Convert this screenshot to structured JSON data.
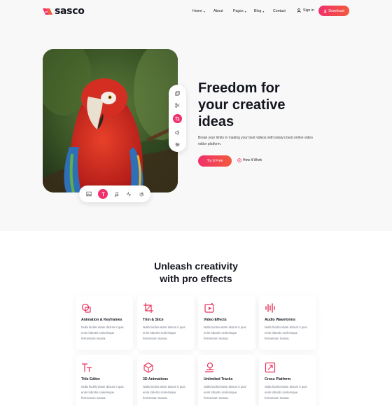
{
  "brand": {
    "name": "sasco",
    "accent": "#f0306a",
    "accent2": "#f25a3e"
  },
  "nav": {
    "items": [
      {
        "label": "Home",
        "has_dropdown": true
      },
      {
        "label": "About",
        "has_dropdown": false
      },
      {
        "label": "Pages",
        "has_dropdown": true
      },
      {
        "label": "Blog",
        "has_dropdown": true
      },
      {
        "label": "Contact",
        "has_dropdown": false
      }
    ],
    "caret": "▾",
    "signin_label": "Sign in",
    "download_label": "Download"
  },
  "hero": {
    "title_lines": [
      "Freedom for",
      "your creative",
      "ideas"
    ],
    "description": "Break your limits in making your best videos with today's best online video editor platform.",
    "primary_cta": "Try It Free",
    "secondary_cta": "How It Work",
    "side_tools": [
      "layers-icon",
      "scissors-icon",
      "crop-icon",
      "volume-icon",
      "sliders-icon"
    ],
    "side_active": "crop-icon",
    "bottom_tools": [
      "image-icon",
      "text-icon",
      "music-icon",
      "waveform-icon",
      "gear-icon"
    ],
    "bottom_active": "text-icon"
  },
  "features": {
    "title_lines": [
      "Unleash creativity",
      "with pro effects"
    ],
    "items": [
      {
        "title": "Animation & Keyframes",
        "desc": "Nulla facilisi etiam dictum it quis enim lobortis scelerisque fermentum massa.",
        "icon": "animation-icon"
      },
      {
        "title": "Trim & Slice",
        "desc": "Nulla facilisi etiam dictum it quis enim lobortis scelerisque fermentum massa.",
        "icon": "crop-icon"
      },
      {
        "title": "Video Effects",
        "desc": "Nulla facilisi etiam dictum it quis enim lobortis scelerisque fermentum massa.",
        "icon": "video-effects-icon"
      },
      {
        "title": "Audio Waveforms",
        "desc": "Nulla facilisi etiam dictum it quis enim lobortis scelerisque fermentum massa.",
        "icon": "audio-waveform-icon"
      },
      {
        "title": "Title Editor",
        "desc": "Nulla facilisi etiam dictum it quis enim lobortis scelerisque fermentum massa.",
        "icon": "title-editor-icon"
      },
      {
        "title": "3D Animations",
        "desc": "Nulla facilisi etiam dictum it quis enim lobortis scelerisque fermentum massa.",
        "icon": "cube-icon"
      },
      {
        "title": "Unlimited Tracks",
        "desc": "Nulla facilisi etiam dictum it quis enim lobortis scelerisque fermentum massa.",
        "icon": "tracks-icon"
      },
      {
        "title": "Cross Platform",
        "desc": "Nulla facilisi etiam dictum it quis enim lobortis scelerisque fermentum massa.",
        "icon": "cross-platform-icon"
      }
    ]
  }
}
